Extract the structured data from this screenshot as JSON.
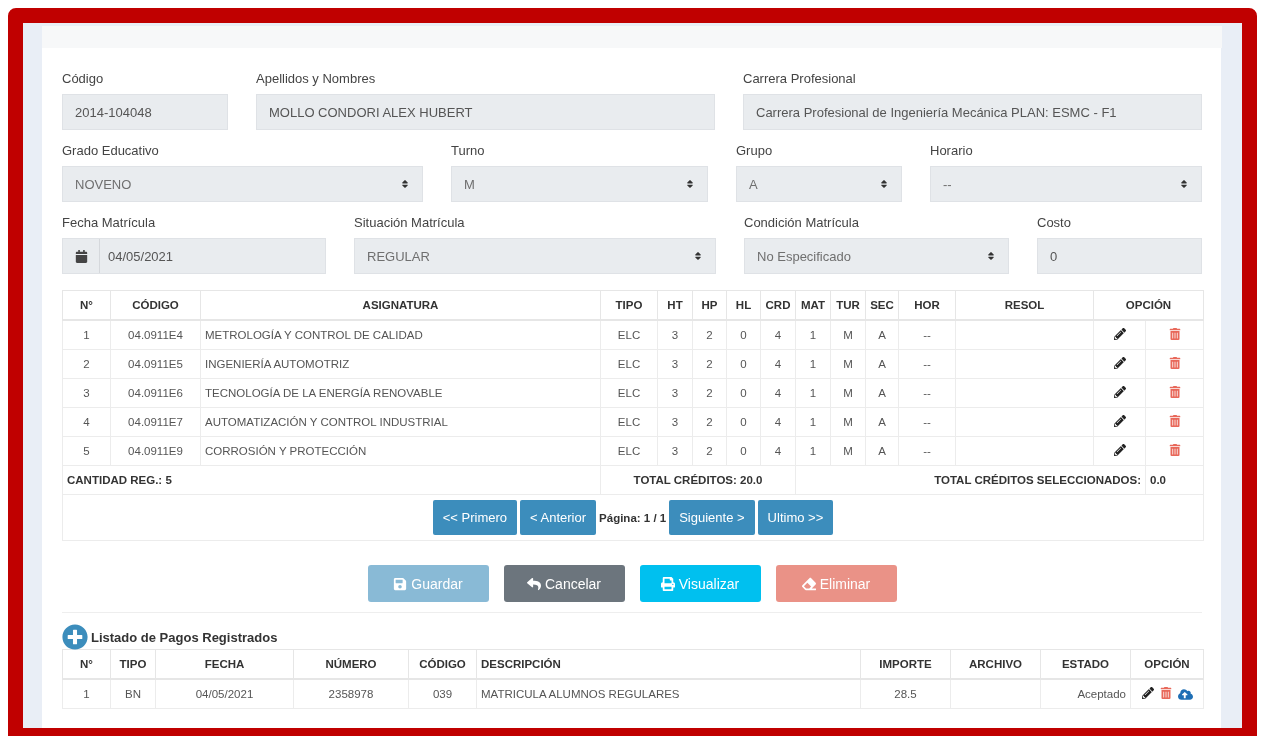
{
  "form": {
    "rows": [
      [
        {
          "label": "Código",
          "kind": "text",
          "value": "2014-104048"
        },
        {
          "label": "Apellidos y Nombres",
          "kind": "text",
          "value": "MOLLO CONDORI ALEX HUBERT"
        },
        {
          "label": "Carrera Profesional",
          "kind": "text",
          "value": "Carrera Profesional de Ingeniería Mecánica  PLAN: ESMC - F1"
        }
      ],
      [
        {
          "label": "Grado Educativo",
          "kind": "select",
          "value": "NOVENO"
        },
        {
          "label": "Turno",
          "kind": "select",
          "value": "M"
        },
        {
          "label": "Grupo",
          "kind": "select",
          "value": "A"
        },
        {
          "label": "Horario",
          "kind": "select",
          "value": "--"
        }
      ],
      [
        {
          "label": "Fecha Matrícula",
          "kind": "date",
          "value": "04/05/2021"
        },
        {
          "label": "Situación Matrícula",
          "kind": "select",
          "value": "REGULAR"
        },
        {
          "label": "Condición Matrícula",
          "kind": "select",
          "value": "No Especificado"
        },
        {
          "label": "Costo",
          "kind": "text",
          "value": "0"
        }
      ]
    ]
  },
  "courses": {
    "columns": [
      "N°",
      "CÓDIGO",
      "ASIGNATURA",
      "TIPO",
      "HT",
      "HP",
      "HL",
      "CRD",
      "MAT",
      "TUR",
      "SEC",
      "HOR",
      "RESOL",
      "OPCIÓN"
    ],
    "rows": [
      [
        "1",
        "04.0911E4",
        "METROLOGÍA Y CONTROL DE CALIDAD",
        "ELC",
        "3",
        "2",
        "0",
        "4",
        "1",
        "M",
        "A",
        "--"
      ],
      [
        "2",
        "04.0911E5",
        "INGENIERÍA AUTOMOTRIZ",
        "ELC",
        "3",
        "2",
        "0",
        "4",
        "1",
        "M",
        "A",
        "--"
      ],
      [
        "3",
        "04.0911E6",
        "TECNOLOGÍA DE LA ENERGÍA RENOVABLE",
        "ELC",
        "3",
        "2",
        "0",
        "4",
        "1",
        "M",
        "A",
        "--"
      ],
      [
        "4",
        "04.0911E7",
        "AUTOMATIZACIÓN Y CONTROL INDUSTRIAL",
        "ELC",
        "3",
        "2",
        "0",
        "4",
        "1",
        "M",
        "A",
        "--"
      ],
      [
        "5",
        "04.0911E9",
        "CORROSIÓN Y PROTECCIÓN",
        "ELC",
        "3",
        "2",
        "0",
        "4",
        "1",
        "M",
        "A",
        "--"
      ]
    ],
    "count": "CANTIDAD REG.: 5",
    "total_credits": "TOTAL CRÉDITOS: 20.0",
    "selected_credits_label": "TOTAL CRÉDITOS SELECCIONADOS:",
    "selected_credits": "0.0",
    "pagination": {
      "first": "<< Primero",
      "prev": "< Anterior",
      "page": "Página: 1 / 1",
      "next": "Siguiente >",
      "last": "Ultimo >>"
    }
  },
  "actions": [
    {
      "label": "Guardar",
      "kind": "save",
      "disabled": true
    },
    {
      "label": "Cancelar",
      "kind": "cancel",
      "disabled": false
    },
    {
      "label": "Visualizar",
      "kind": "print",
      "disabled": false
    },
    {
      "label": "Eliminar",
      "kind": "delete",
      "disabled": true
    }
  ],
  "payments": {
    "title": "Listado de Pagos Registrados",
    "columns": [
      "N°",
      "TIPO",
      "FECHA",
      "NÚMERO",
      "CÓDIGO",
      "DESCRIPCIÓN",
      "IMPORTE",
      "ARCHIVO",
      "ESTADO",
      "OPCIÓN"
    ],
    "rows": [
      [
        "1",
        "BN",
        "04/05/2021",
        "2358978",
        "039",
        "MATRICULA ALUMNOS REGULARES",
        "28.5",
        "",
        "Aceptado"
      ]
    ]
  }
}
